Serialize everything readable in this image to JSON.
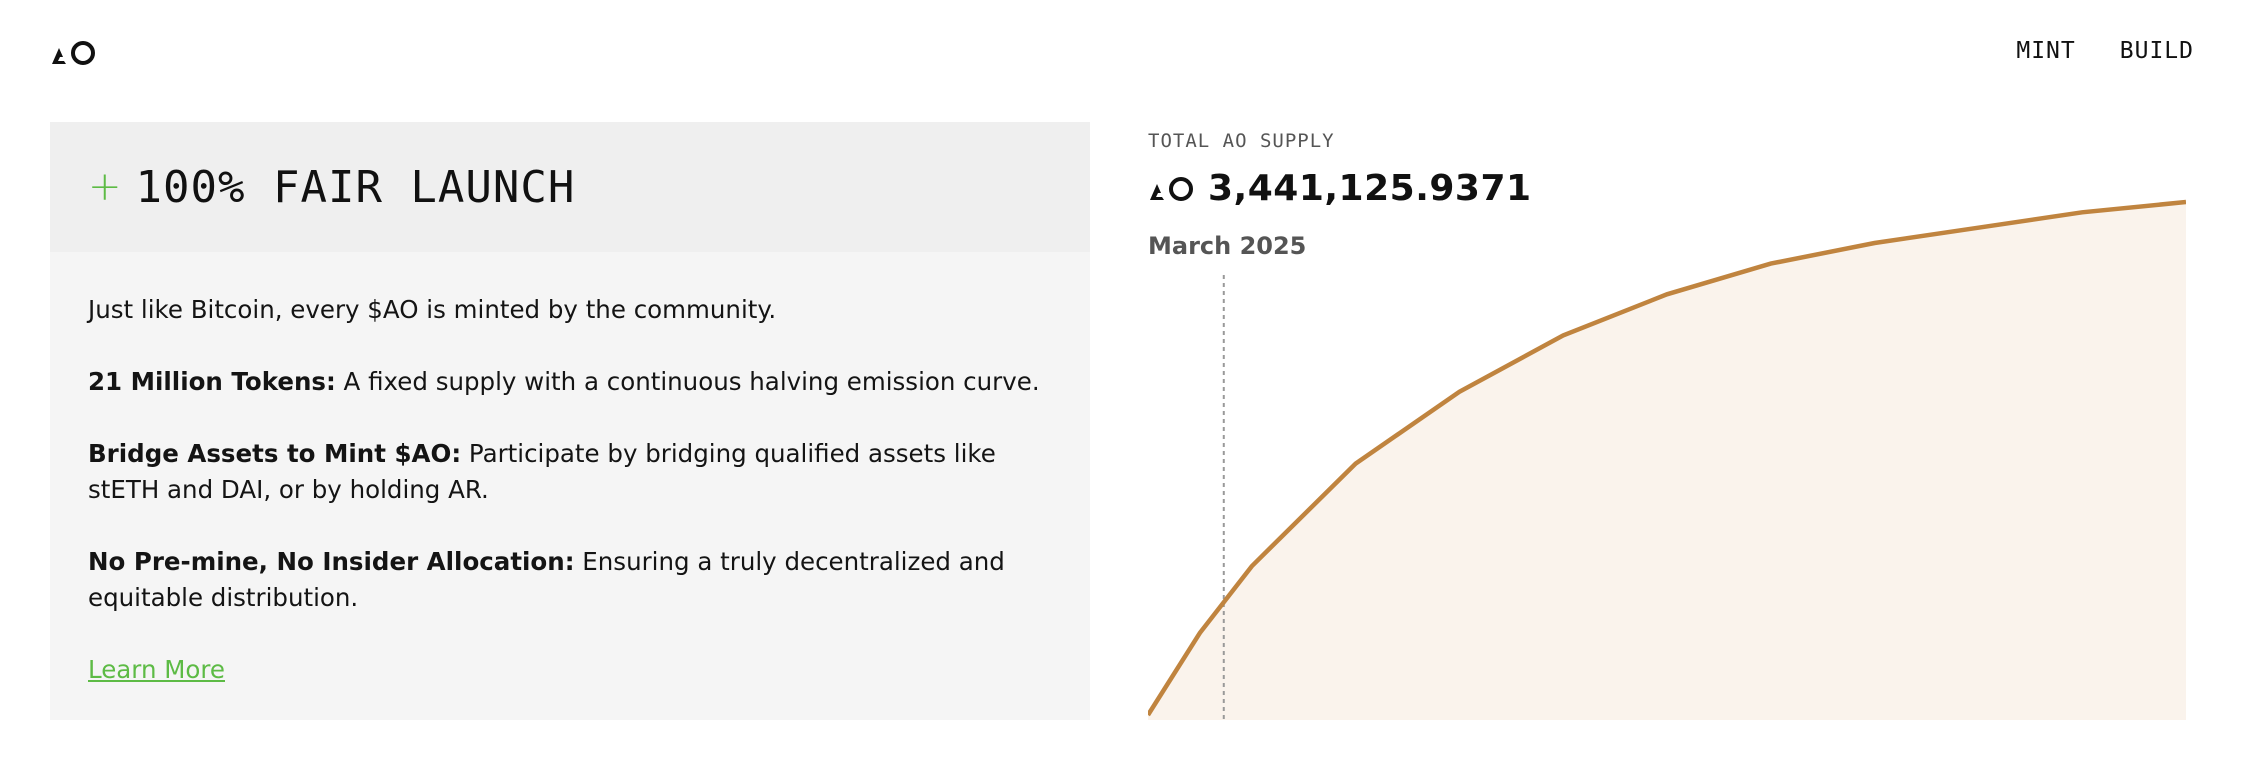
{
  "header": {
    "logo_icon": "ao-logo-icon",
    "nav": [
      {
        "label": "MINT"
      },
      {
        "label": "BUILD"
      }
    ]
  },
  "panel": {
    "plus_icon": "plus-icon",
    "headline": "100% FAIR LAUNCH",
    "intro": "Just like Bitcoin, every $AO is minted by the community.",
    "points": [
      {
        "title": "21 Million Tokens:",
        "text": " A fixed supply with a continuous halving emission curve."
      },
      {
        "title": "Bridge Assets to Mint $AO:",
        "text": " Participate by bridging qualified assets like stETH and DAI, or by holding AR."
      },
      {
        "title": "No Pre-mine, No Insider Allocation:",
        "text": " Ensuring a truly decentralized and equitable distribution."
      }
    ],
    "link": "Learn More"
  },
  "supply": {
    "label": "TOTAL AO SUPPLY",
    "value": "3,441,125.9371",
    "date": "March 2025"
  },
  "chart_data": {
    "type": "area",
    "title": "",
    "xlabel": "",
    "ylabel": "",
    "series": [
      {
        "x": [
          0,
          0.05,
          0.1,
          0.2,
          0.3,
          0.4,
          0.5,
          0.6,
          0.7,
          0.8,
          0.9,
          1.0
        ],
        "values": [
          0.0,
          0.16,
          0.29,
          0.49,
          0.63,
          0.74,
          0.82,
          0.88,
          0.92,
          0.95,
          0.98,
          1.0
        ]
      }
    ],
    "marker_x": 0.073,
    "colors": {
      "line": "#c0843f",
      "fill": "#faf3ec",
      "marker": "#999999"
    }
  }
}
